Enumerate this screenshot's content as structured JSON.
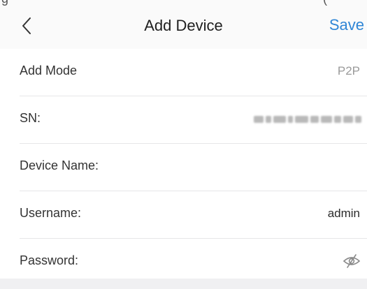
{
  "header": {
    "title": "Add Device",
    "save_label": "Save",
    "back_icon": "chevron-left-icon",
    "cropped_text_left": "g",
    "cropped_text_right": "("
  },
  "form": {
    "add_mode": {
      "label": "Add Mode",
      "value": "P2P"
    },
    "sn": {
      "label": "SN:",
      "value_state": "blurred"
    },
    "device_name": {
      "label": "Device Name:",
      "value": ""
    },
    "username": {
      "label": "Username:",
      "value": "admin"
    },
    "password": {
      "label": "Password:",
      "toggle_icon": "eye-slash-icon"
    }
  },
  "colors": {
    "accent": "#2f86d6",
    "background": "#f4f4f6",
    "label": "#333333",
    "muted_value": "#9a9a9a"
  }
}
